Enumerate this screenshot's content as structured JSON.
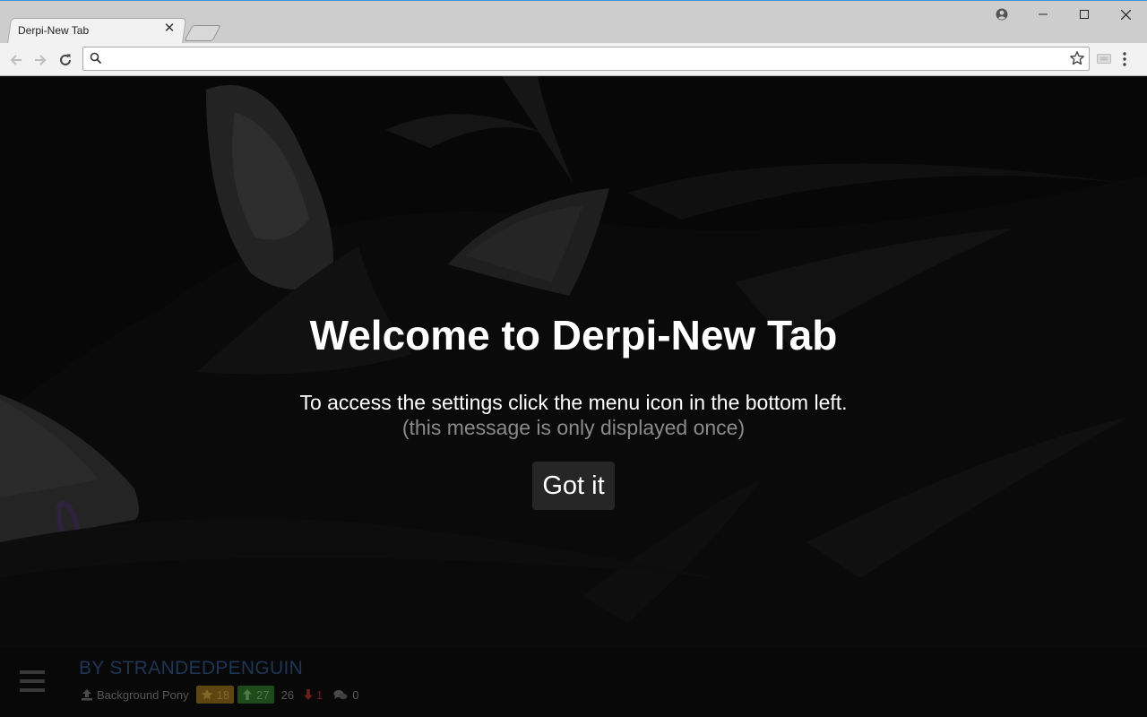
{
  "browser": {
    "tab_title": "Derpi-New Tab",
    "address_value": "",
    "address_placeholder": ""
  },
  "welcome": {
    "title": "Welcome to Derpi-New Tab",
    "text": "To access the settings click the menu icon in the bottom left.",
    "subtext": "(this message is only displayed once)",
    "button_label": "Got it"
  },
  "image_info": {
    "artist": "BY STRANDEDPENGUIN",
    "tag": "Background Pony",
    "faves": "18",
    "upvotes": "27",
    "score": "26",
    "downvotes": "1",
    "comments": "0"
  },
  "colors": {
    "accent": "#3c8fd6",
    "faves_badge": "#5c4510",
    "upvote_badge": "#1f4a1a",
    "downvote": "#6a1e1e"
  },
  "icons": [
    "profile-icon",
    "minimize-icon",
    "maximize-icon",
    "close-icon",
    "back-icon",
    "forward-icon",
    "reload-icon",
    "search-icon",
    "bookmark-star-icon",
    "extension-icon",
    "menu-dots-icon",
    "hamburger-menu-icon",
    "upload-icon",
    "star-icon",
    "arrow-up-icon",
    "arrow-down-icon",
    "comments-icon"
  ]
}
